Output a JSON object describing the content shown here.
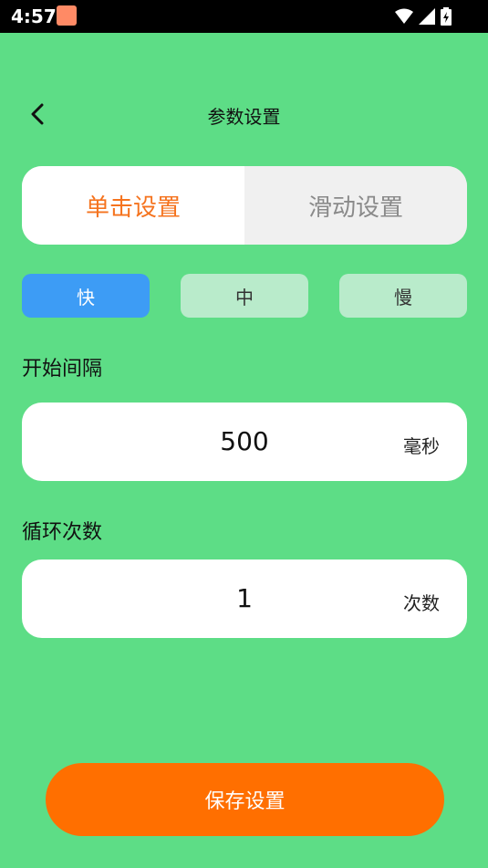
{
  "status_bar": {
    "time": "4:57",
    "icons": [
      "app-notification-icon",
      "wifi-icon",
      "signal-icon",
      "battery-icon"
    ]
  },
  "header": {
    "title": "参数设置",
    "back_icon": "back-arrow-icon"
  },
  "tabs": [
    {
      "label": "单击设置",
      "active": true
    },
    {
      "label": "滑动设置",
      "active": false
    }
  ],
  "speed_options": [
    {
      "label": "快",
      "selected": true
    },
    {
      "label": "中",
      "selected": false
    },
    {
      "label": "慢",
      "selected": false
    }
  ],
  "start_interval": {
    "label": "开始间隔",
    "value": "500",
    "unit": "毫秒"
  },
  "loop_count": {
    "label": "循环次数",
    "value": "1",
    "unit": "次数"
  },
  "save_button": {
    "label": "保存设置"
  },
  "colors": {
    "background": "#5ddd86",
    "accent_orange": "#ff6f00",
    "tab_active_text": "#f5731e",
    "speed_selected": "#3d9cf5",
    "speed_unselected": "#b9ebcb"
  }
}
